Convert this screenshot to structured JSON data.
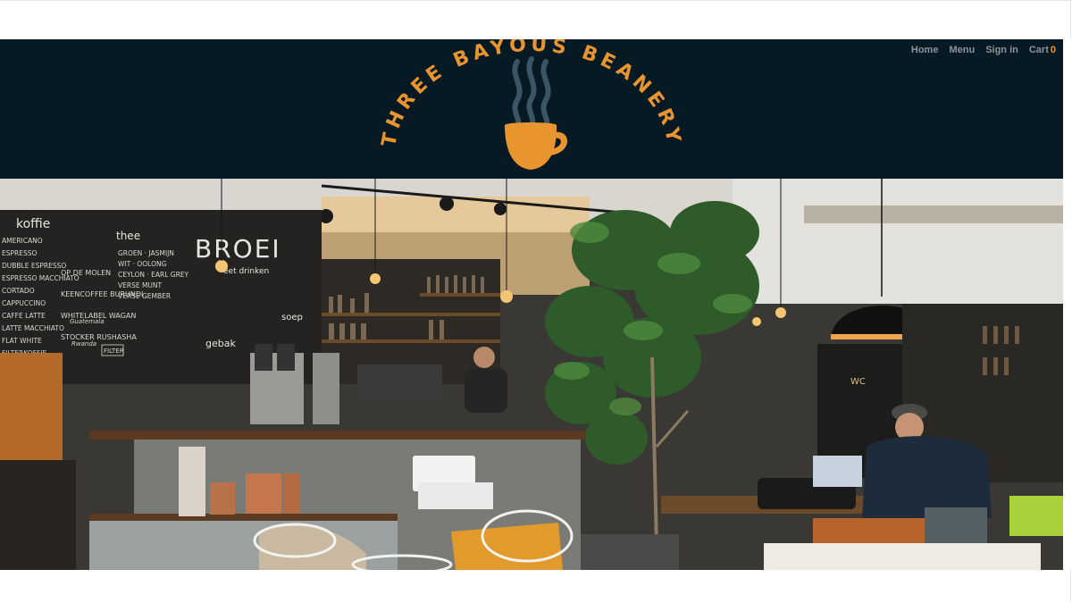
{
  "nav": {
    "home": "Home",
    "menu": "Menu",
    "signin": "Sign in",
    "cart_label": "Cart",
    "cart_count": "0"
  },
  "brand": {
    "name": "THREE BAYOUS BEANERY",
    "logo_color": "#e8952f",
    "steam_color": "#3b5566",
    "header_bg": "#071a24"
  },
  "hero": {
    "chalk_title": "BROEI",
    "chalk_subtitle": "eet drinken",
    "chalk_coffee": "koffie",
    "chalk_tea": "thee",
    "chalk_soup": "soep",
    "chalk_gebak": "gebak",
    "chalk_wc": "WC",
    "chalk_items": [
      "AMERICANO",
      "ESPRESSO",
      "DUBBLE ESPRESSO",
      "ESPRESSO MACCHIATO",
      "CORTADO",
      "CAPPUCCINO",
      "CAFFE LATTE",
      "LATTE MACCHIATO",
      "FLAT WHITE",
      "FILTERKOFFIE"
    ],
    "chalk_tea_items": [
      "GROEN · JASMIJN",
      "WIT · OOLONG",
      "CEYLON · EARL GREY",
      "VERSE MUNT",
      "VERSE GEMBER"
    ],
    "chalk_side_items": [
      "OP DE MOLEN",
      "KEENCOFFEE BURUNDI",
      "WHITELABEL WAGAN",
      "STOCKER RUSHASHA"
    ],
    "chalk_filter": "FILTER",
    "chalk_rwanda": "Rwanda",
    "chalk_guatemala": "Guatemala"
  }
}
